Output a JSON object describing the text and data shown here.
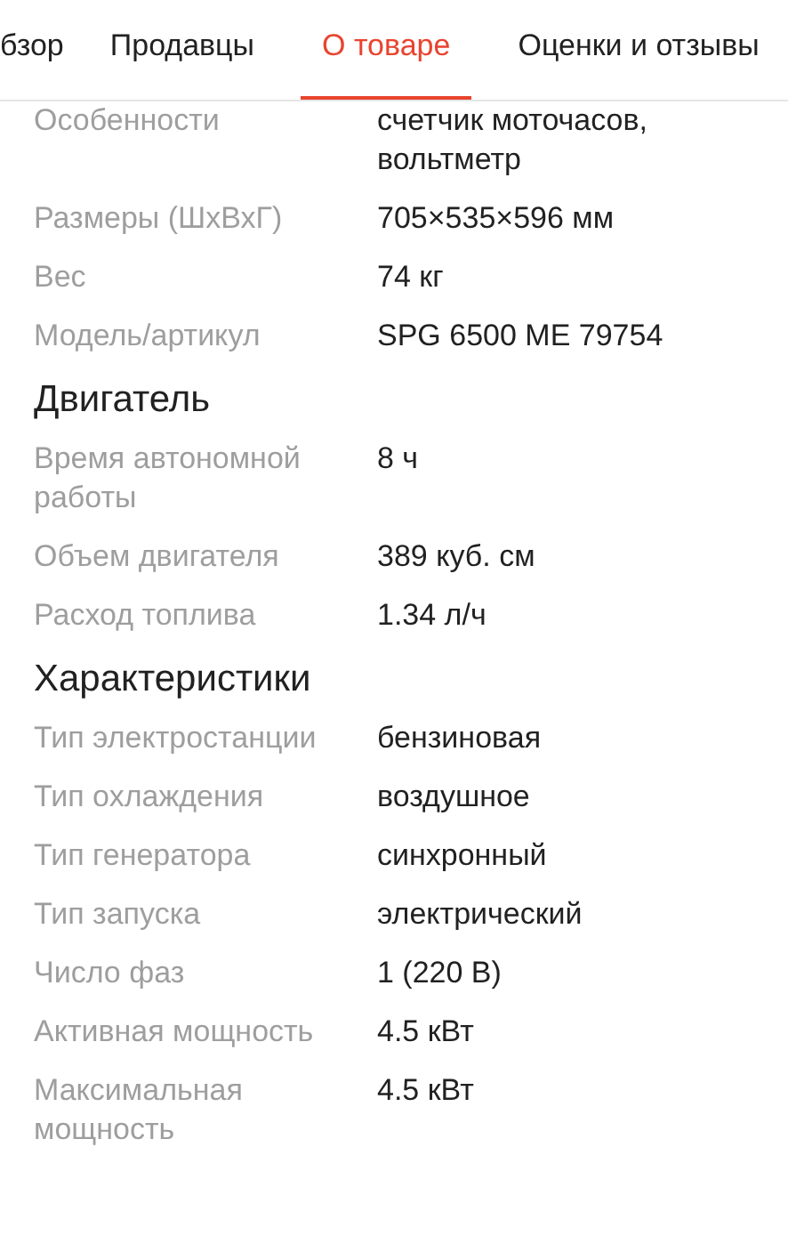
{
  "tabs": [
    {
      "label": "бзор",
      "selected": false
    },
    {
      "label": "Продавцы",
      "selected": false
    },
    {
      "label": "О товаре",
      "selected": true
    },
    {
      "label": "Оценки и отзывы",
      "selected": false
    }
  ],
  "sections": [
    {
      "rows": [
        {
          "label": "Особенности",
          "value": "счетчик моточасов, вольтметр"
        },
        {
          "label": "Размеры (ШхВхГ)",
          "value": "705×535×596 мм"
        },
        {
          "label": "Вес",
          "value": "74 кг"
        },
        {
          "label": "Модель/артикул",
          "value": "SPG 6500 ME 79754"
        }
      ]
    },
    {
      "title": "Двигатель",
      "rows": [
        {
          "label": "Время автономной работы",
          "value": "8 ч"
        },
        {
          "label": "Объем двигателя",
          "value": "389 куб. см"
        },
        {
          "label": "Расход топлива",
          "value": "1.34 л/ч"
        }
      ]
    },
    {
      "title": "Характеристики",
      "rows": [
        {
          "label": "Тип электростанции",
          "value": "бензиновая"
        },
        {
          "label": "Тип охлаждения",
          "value": "воздушное"
        },
        {
          "label": "Тип генератора",
          "value": "синхронный"
        },
        {
          "label": "Тип запуска",
          "value": "электрический"
        },
        {
          "label": "Число фаз",
          "value": "1 (220 В)"
        },
        {
          "label": "Активная мощность",
          "value": "4.5 кВт"
        },
        {
          "label": "Максимальная мощность",
          "value": "4.5 кВт"
        }
      ]
    }
  ]
}
